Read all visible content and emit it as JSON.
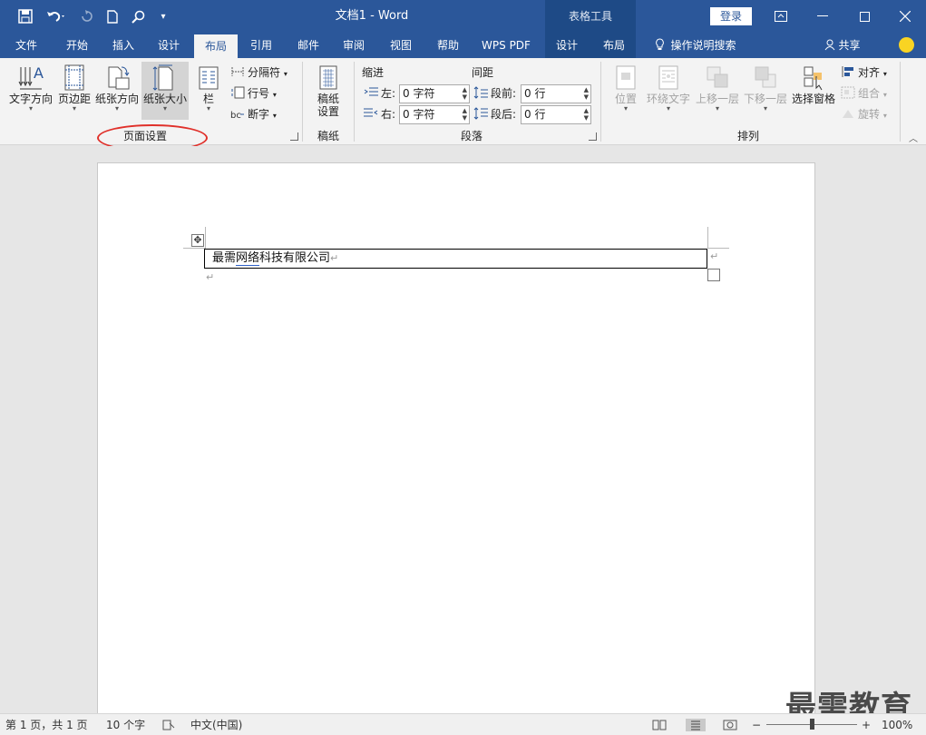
{
  "titlebar": {
    "doc_title": "文档1 - Word",
    "context_group": "表格工具",
    "login_label": "登录"
  },
  "tabs": [
    "文件",
    "开始",
    "插入",
    "设计",
    "布局",
    "引用",
    "邮件",
    "审阅",
    "视图",
    "帮助",
    "WPS PDF",
    "设计",
    "布局",
    "操作说明搜索",
    "共享"
  ],
  "ribbon": {
    "page_setup": {
      "text_direction": "文字方向",
      "margins": "页边距",
      "orientation": "纸张方向",
      "size": "纸张大小",
      "columns": "栏",
      "breaks": "分隔符",
      "line_numbers": "行号",
      "hyphenation": "断字",
      "group_label": "页面设置"
    },
    "manuscript": {
      "settings_line1": "稿纸",
      "settings_line2": "设置",
      "group_label": "稿纸"
    },
    "paragraph": {
      "indent_header": "缩进",
      "spacing_header": "间距",
      "left_label": "左:",
      "left_value": "0 字符",
      "right_label": "右:",
      "right_value": "0 字符",
      "before_label": "段前:",
      "before_value": "0 行",
      "after_label": "段后:",
      "after_value": "0 行",
      "group_label": "段落"
    },
    "arrange": {
      "position": "位置",
      "wrap_text": "环绕文字",
      "bring_forward": "上移一层",
      "send_backward": "下移一层",
      "selection_pane": "选择窗格",
      "align": "对齐",
      "group": "组合",
      "rotate": "旋转",
      "group_label": "排列"
    }
  },
  "document": {
    "cell_text_1": "最需",
    "cell_text_2": "网络",
    "cell_text_3": "科技有限公司"
  },
  "watermark": "最需教育",
  "statusbar": {
    "page_info": "第 1 页，共 1 页",
    "word_count": "10 个字",
    "language": "中文(中国)",
    "zoom_minus": "−",
    "zoom_plus": "+",
    "zoom_level": "100%"
  },
  "colors": {
    "accent": "#2b579a",
    "context_tab_bg": "#1e4a86",
    "highlight_ellipse": "#e0302a"
  }
}
